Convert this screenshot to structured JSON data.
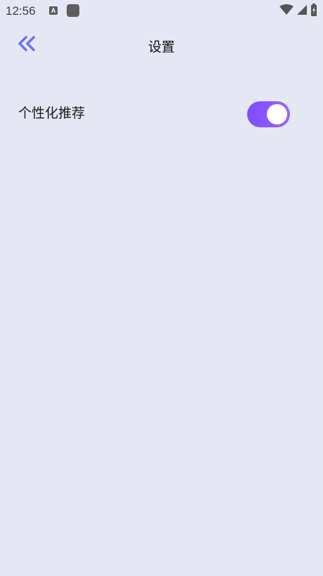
{
  "status_bar": {
    "time": "12:56",
    "a_icon_letter": "A",
    "icons": [
      "wifi-icon",
      "signal-icon",
      "battery-icon"
    ]
  },
  "header": {
    "title": "设置",
    "back_icon": "double-chevron-left-icon",
    "back_icon_color": "#6a74e8"
  },
  "settings": {
    "items": [
      {
        "label": "个性化推荐",
        "enabled": true,
        "toggle_color": "#8656ff"
      }
    ]
  },
  "colors": {
    "background": "#e6e7f4"
  }
}
